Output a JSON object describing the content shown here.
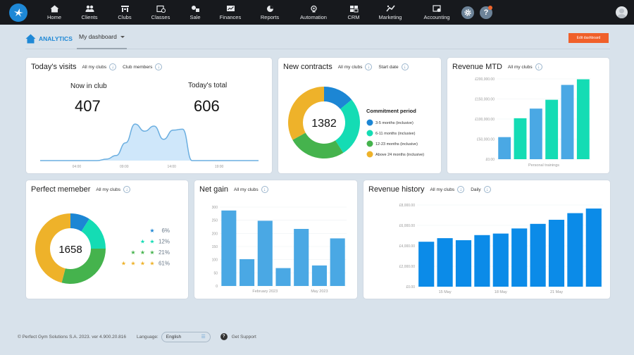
{
  "nav": {
    "items": [
      {
        "label": "Home",
        "icon": "home-icon"
      },
      {
        "label": "Clients",
        "icon": "clients-icon"
      },
      {
        "label": "Clubs",
        "icon": "clubs-icon"
      },
      {
        "label": "Classes",
        "icon": "classes-icon"
      },
      {
        "label": "Sale",
        "icon": "sale-icon"
      },
      {
        "label": "Finances",
        "icon": "finances-icon"
      },
      {
        "label": "Reports",
        "icon": "reports-icon"
      },
      {
        "label": "Automation",
        "icon": "automation-icon"
      },
      {
        "label": "CRM",
        "icon": "crm-icon"
      },
      {
        "label": "Marketing",
        "icon": "marketing-icon"
      },
      {
        "label": "Accounting",
        "icon": "accounting-icon"
      }
    ],
    "settings_icon": "gear-icon",
    "help_label": "?",
    "colors": {
      "bar": "#17191d",
      "logo": "#1e88d6",
      "notification": "#f0652c"
    }
  },
  "subheader": {
    "section": "ANALYTICS",
    "dashboard_tab": "My dashboard",
    "edit_button": "Edit dashboard",
    "accent": "#1e88d6",
    "edit_color": "#f0602a"
  },
  "visits": {
    "title": "Today's visits",
    "filters": [
      "All my clubs",
      "Club members"
    ],
    "now_label": "Now in club",
    "now_value": "407",
    "total_label": "Today's total",
    "total_value": "606"
  },
  "contracts": {
    "title": "New contracts",
    "filters": [
      "All my clubs",
      "Start date"
    ],
    "total": "1382",
    "legend_title": "Commitment period"
  },
  "revenue_mtd": {
    "title": "Revenue MTD",
    "filters": [
      "All my clubs"
    ]
  },
  "perfect": {
    "title": "Perfect memeber",
    "filters": [
      "All my clubs"
    ],
    "total": "1658"
  },
  "net_gain": {
    "title": "Net gain",
    "filters": [
      "All my clubs"
    ]
  },
  "revenue_history": {
    "title": "Revenue history",
    "filters": [
      "All my clubs",
      "Daily"
    ]
  },
  "footer": {
    "copyright": "© Perfect Gym Solutions S.A. 2023. ver 4.900.20.816",
    "language_label": "Language:",
    "language_value": "English",
    "support": "Get Support"
  },
  "chart_data": [
    {
      "id": "visits",
      "type": "area",
      "title": "Today's visits",
      "x_ticks": [
        "04:00",
        "09:00",
        "14:00",
        "19:00"
      ],
      "x": [
        0,
        1,
        2,
        3,
        4,
        5,
        6,
        7,
        8,
        9,
        10,
        11,
        12,
        13,
        14,
        15,
        16,
        17,
        18,
        19,
        20,
        21,
        22,
        23
      ],
      "values": [
        0,
        0,
        0,
        0,
        0,
        0,
        0,
        3,
        10,
        35,
        72,
        58,
        68,
        42,
        60,
        62,
        0,
        0,
        0,
        0,
        0,
        0,
        0,
        0
      ],
      "color": "#6aaee0",
      "fill": "#cfe7fa"
    },
    {
      "id": "contracts",
      "type": "pie",
      "title": "New contracts",
      "legend_title": "Commitment period",
      "slices": [
        {
          "label": "3-5 months (inclusive)",
          "value": 14,
          "color": "#1c86d4"
        },
        {
          "label": "6-11 months (inclusive)",
          "value": 27,
          "color": "#14dcb4"
        },
        {
          "label": "12-23 months (inclusive)",
          "value": 26,
          "color": "#45b34d"
        },
        {
          "label": "Above 24 months (inclusive)",
          "value": 33,
          "color": "#eeb22a"
        }
      ],
      "center_label": "1382"
    },
    {
      "id": "revenue_mtd",
      "type": "bar",
      "title": "Revenue MTD",
      "xlabel": "Personal trainings",
      "y_ticks": [
        "£0.00",
        "£50,000.00",
        "£100,000.00",
        "£150,000.00",
        "£200,000.00"
      ],
      "ylim": [
        0,
        200000
      ],
      "values": [
        55000,
        102000,
        126000,
        148000,
        185000,
        199000
      ],
      "colors": [
        "#4aa8e4",
        "#14dcb4",
        "#4aa8e4",
        "#14dcb4",
        "#4aa8e4",
        "#14dcb4"
      ]
    },
    {
      "id": "perfect",
      "type": "pie",
      "title": "Perfect memeber",
      "slices": [
        {
          "label": "1 star",
          "stars": 1,
          "value": 6,
          "pct": "6%",
          "color": "#1c86d4"
        },
        {
          "label": "2 stars",
          "stars": 2,
          "value": 12,
          "pct": "12%",
          "color": "#14dcb4"
        },
        {
          "label": "3 stars",
          "stars": 3,
          "value": 21,
          "pct": "21%",
          "color": "#45b34d"
        },
        {
          "label": "4 stars",
          "stars": 4,
          "value": 61,
          "pct": "61%",
          "color": "#eeb22a"
        }
      ],
      "display_fractions": [
        0.09,
        0.16,
        0.29,
        0.46
      ],
      "center_label": "1658"
    },
    {
      "id": "net_gain",
      "type": "bar",
      "title": "Net gain",
      "x_ticks": [
        "February 2023",
        "May 2023"
      ],
      "y_ticks": [
        "0",
        "50",
        "100",
        "150",
        "200",
        "250",
        "300"
      ],
      "ylim": [
        0,
        300
      ],
      "values": [
        287,
        102,
        248,
        68,
        217,
        78,
        181
      ],
      "tick_positions": [
        2.5,
        5.5
      ],
      "color": "#4aa8e4"
    },
    {
      "id": "revenue_history",
      "type": "bar",
      "title": "Revenue history",
      "x_ticks": [
        "15 May",
        "18 May",
        "21 May"
      ],
      "y_ticks": [
        "£0.00",
        "£2,000.00",
        "£4,000.00",
        "£6,000.00",
        "£8,000.00"
      ],
      "ylim": [
        0,
        8000
      ],
      "values": [
        4400,
        4750,
        4550,
        5050,
        5200,
        5700,
        6150,
        6550,
        7200,
        7650
      ],
      "tick_positions": [
        1.5,
        4.5,
        7.5
      ],
      "color": "#0b8be8"
    }
  ]
}
